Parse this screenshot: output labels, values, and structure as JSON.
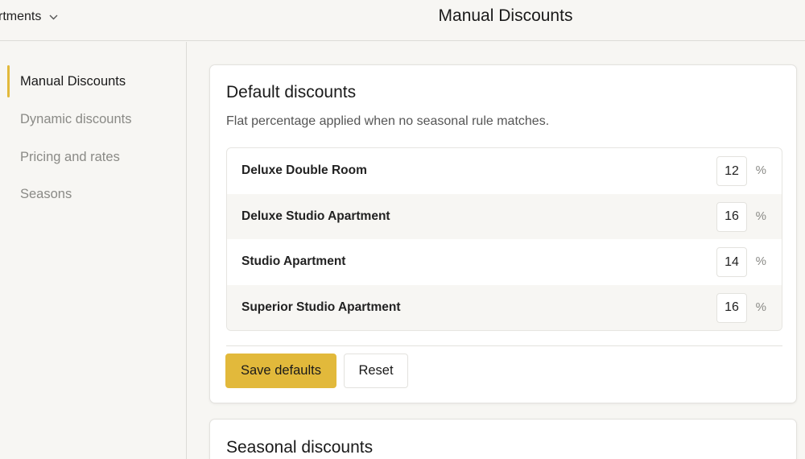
{
  "header": {
    "property_label": "rtments",
    "page_title": "Manual Discounts"
  },
  "sidebar": {
    "items": [
      {
        "label": "Manual Discounts",
        "active": true
      },
      {
        "label": "Dynamic discounts",
        "active": false
      },
      {
        "label": "Pricing and rates",
        "active": false
      },
      {
        "label": "Seasons",
        "active": false
      }
    ]
  },
  "default_discounts": {
    "title": "Default discounts",
    "subtitle": "Flat percentage applied when no seasonal rule matches.",
    "rooms": [
      {
        "name": "Deluxe Double Room",
        "value": "12",
        "unit": "%"
      },
      {
        "name": "Deluxe Studio Apartment",
        "value": "16",
        "unit": "%"
      },
      {
        "name": "Studio Apartment",
        "value": "14",
        "unit": "%"
      },
      {
        "name": "Superior Studio Apartment",
        "value": "16",
        "unit": "%"
      }
    ],
    "save_label": "Save defaults",
    "reset_label": "Reset"
  },
  "seasonal_discounts": {
    "title": "Seasonal discounts"
  },
  "colors": {
    "accent": "#e2b93b",
    "background": "#f7f6f3",
    "card": "#ffffff"
  },
  "icons": {
    "property_switcher": "chevron-down-icon"
  }
}
